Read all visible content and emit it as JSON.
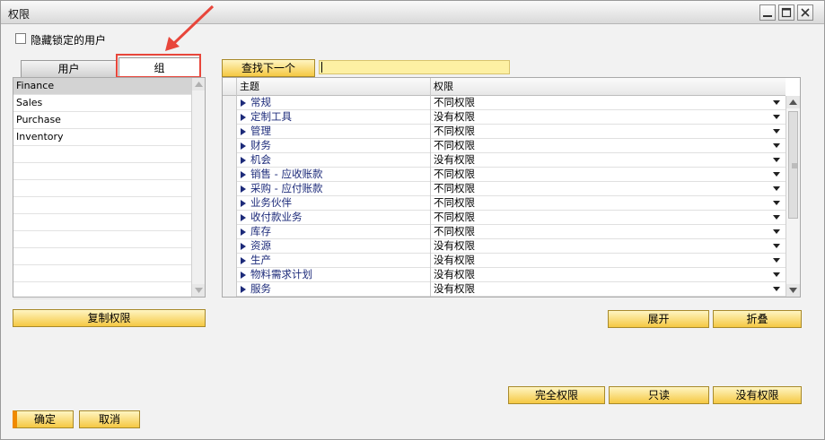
{
  "window": {
    "title": "权限"
  },
  "options": {
    "hide_locked_users_label": "隐藏锁定的用户"
  },
  "tabs": {
    "users": "用户",
    "groups": "组"
  },
  "group_list": [
    "Finance",
    "Sales",
    "Purchase",
    "Inventory"
  ],
  "selected_group": "Finance",
  "search": {
    "find_next_label": "查找下一个",
    "value": ""
  },
  "grid": {
    "headers": {
      "subject": "主题",
      "permission": "权限"
    },
    "rows": [
      {
        "subject": "常规",
        "permission": "不同权限"
      },
      {
        "subject": "定制工具",
        "permission": "没有权限"
      },
      {
        "subject": "管理",
        "permission": "不同权限"
      },
      {
        "subject": "财务",
        "permission": "不同权限"
      },
      {
        "subject": "机会",
        "permission": "没有权限"
      },
      {
        "subject": "销售 - 应收账款",
        "permission": "不同权限"
      },
      {
        "subject": "采购 - 应付账款",
        "permission": "不同权限"
      },
      {
        "subject": "业务伙伴",
        "permission": "不同权限"
      },
      {
        "subject": "收付款业务",
        "permission": "不同权限"
      },
      {
        "subject": "库存",
        "permission": "不同权限"
      },
      {
        "subject": "资源",
        "permission": "没有权限"
      },
      {
        "subject": "生产",
        "permission": "没有权限"
      },
      {
        "subject": "物料需求计划",
        "permission": "没有权限"
      },
      {
        "subject": "服务",
        "permission": "没有权限"
      }
    ]
  },
  "buttons": {
    "copy_permissions": "复制权限",
    "expand": "展开",
    "collapse": "折叠",
    "full_authorization": "完全权限",
    "read_only": "只读",
    "no_authorization": "没有权限",
    "ok": "确定",
    "cancel": "取消"
  },
  "colors": {
    "button_yellow": "#f5c842",
    "search_field": "#fdf0a3",
    "subject_text": "#1d2b7a",
    "annotation_red": "#e8463b",
    "selected_row": "#d3d3d3"
  },
  "icons": [
    "minimize-icon",
    "maximize-icon",
    "close-icon",
    "expand-triangle-icon",
    "dropdown-arrow-icon",
    "expand-grid-icon",
    "annotation-arrow-icon"
  ]
}
